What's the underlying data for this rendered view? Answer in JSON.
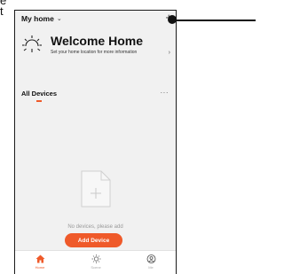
{
  "annotation": {
    "fragment_top": "e",
    "fragment_side": "t"
  },
  "header": {
    "home_name": "My home",
    "chevron": "⌄",
    "add_glyph": "+"
  },
  "welcome": {
    "title": "Welcome Home",
    "subtitle": "Set your home location for more information",
    "arrow": "›",
    "icon": "sun-icon"
  },
  "devices": {
    "label": "All Devices",
    "more": "···"
  },
  "empty_state": {
    "message": "No devices, please add",
    "icon": "blank-document-icon"
  },
  "add_button": {
    "label": "Add Device"
  },
  "tabs": [
    {
      "label": "Home",
      "icon": "home-icon"
    },
    {
      "label": "Scene",
      "icon": "scene-sun-icon"
    },
    {
      "label": "Me",
      "icon": "profile-icon"
    }
  ],
  "colors": {
    "accent": "#ef5a2a",
    "background": "#f1f1f1",
    "callout": "#111111"
  }
}
